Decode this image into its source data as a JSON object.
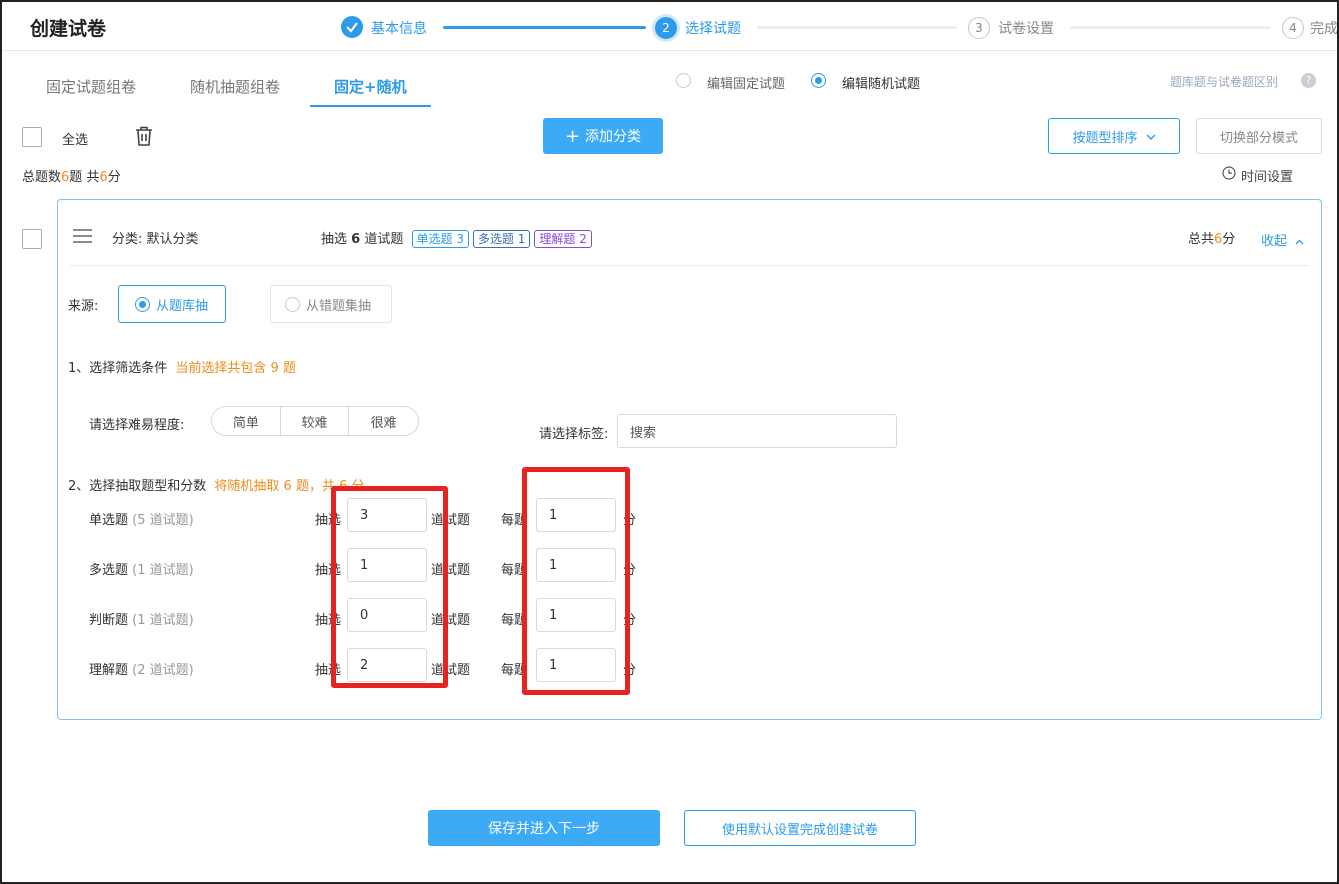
{
  "page_title": "创建试卷",
  "steps": [
    {
      "num": "1",
      "label": "基本信息",
      "state": "done"
    },
    {
      "num": "2",
      "label": "选择试题",
      "state": "active"
    },
    {
      "num": "3",
      "label": "试卷设置",
      "state": "todo"
    },
    {
      "num": "4",
      "label": "完成",
      "state": "todo"
    }
  ],
  "tabs": [
    "固定试题组卷",
    "随机抽题组卷",
    "固定+随机"
  ],
  "edit_mode": {
    "fixed": "编辑固定试题",
    "random": "编辑随机试题",
    "selected": "random"
  },
  "help_link": "题库题与试卷题区别",
  "toolbar": {
    "select_all": "全选",
    "add_category": "添加分类",
    "sort_by_type": "按题型排序",
    "switch_mode": "切换部分模式",
    "time_setting": "时间设置"
  },
  "summary": {
    "prefix": "总题数",
    "count": "6",
    "mid": "题 共",
    "score": "6",
    "suffix": "分"
  },
  "category": {
    "name": "分类: 默认分类",
    "draw_prefix": "抽选",
    "draw_count": "6",
    "draw_suffix": "道试题",
    "tags": [
      "单选题 3",
      "多选题 1",
      "理解题 2"
    ],
    "total_prefix": "总共",
    "total_score": "6",
    "total_suffix": "分",
    "collapse": "收起",
    "source_label": "来源:",
    "source_options": [
      "从题库抽",
      "从错题集抽"
    ],
    "source_selected": 0,
    "step1_title": "1、选择筛选条件",
    "step1_note": "当前选择共包含 9 题",
    "difficulty_label": "请选择难易程度:",
    "difficulties": [
      "简单",
      "较难",
      "很难"
    ],
    "tag_label": "请选择标签:",
    "tag_placeholder": "搜索",
    "step2_title": "2、选择抽取题型和分数",
    "step2_note": "将随机抽取 6 题，共 6 分",
    "rows": [
      {
        "type": "单选题",
        "avail": "(5 道试题)",
        "draw": "3",
        "score": "1"
      },
      {
        "type": "多选题",
        "avail": "(1 道试题)",
        "draw": "1",
        "score": "1"
      },
      {
        "type": "判断题",
        "avail": "(1 道试题)",
        "draw": "0",
        "score": "1"
      },
      {
        "type": "理解题",
        "avail": "(2 道试题)",
        "draw": "2",
        "score": "1"
      }
    ],
    "row_draw_label": "抽选",
    "row_unit_label": "道试题",
    "row_each_label": "每题",
    "row_score_unit": "分"
  },
  "footer": {
    "save_next": "保存并进入下一步",
    "default_finish": "使用默认设置完成创建试卷"
  },
  "colors": {
    "accent": "#2b9bea",
    "highlight": "#f08c1a",
    "annotation": "#e8221f"
  }
}
